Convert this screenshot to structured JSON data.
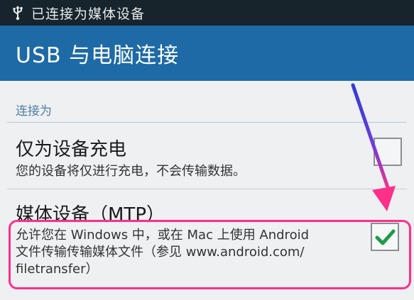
{
  "status_bar": {
    "icon": "usb-icon",
    "text": "已连接为媒体设备"
  },
  "action_bar": {
    "title": "USB 与电脑连接"
  },
  "section": {
    "header": "连接为"
  },
  "options": [
    {
      "title": "仅为设备充电",
      "description": "您的设备将仅进行充电，不会传输数据。",
      "checked": false
    },
    {
      "title": "媒体设备（MTP）",
      "description_lines": [
        "允许您在 Windows 中，或在 Mac 上使用 Android",
        "文件传输传输媒体文件（参见 www.android.com/",
        "filetransfer）"
      ],
      "checked": true
    }
  ],
  "colors": {
    "status_bar_bg": "#17242c",
    "action_bar_bg": "#1e6aa6",
    "check_green": "#1f9a4a",
    "highlight_pink": "#ff2f8a",
    "arrow_blue": "#3b3fe0"
  }
}
